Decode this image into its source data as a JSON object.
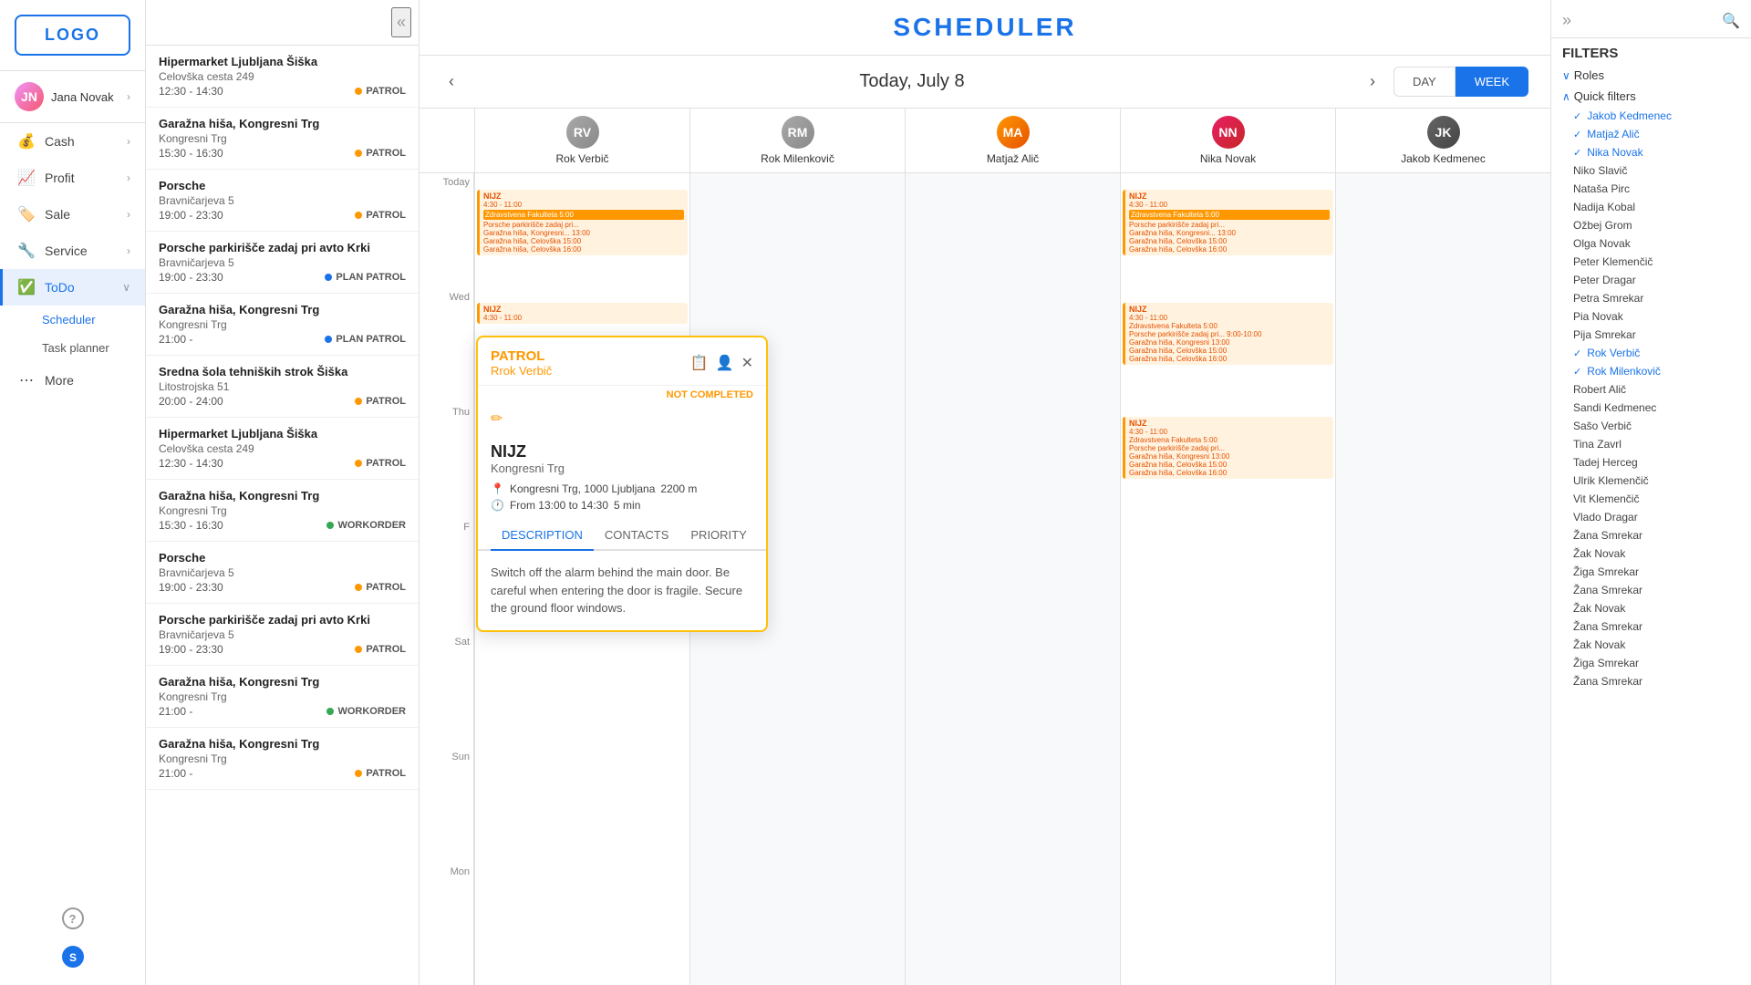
{
  "app": {
    "title": "SCHEDULER",
    "logo": "LOGO"
  },
  "user": {
    "name": "Jana Novak",
    "initials": "JN"
  },
  "nav": {
    "items": [
      {
        "id": "cash",
        "label": "Cash",
        "icon": "💰",
        "hasArrow": true
      },
      {
        "id": "profit",
        "label": "Profit",
        "icon": "📈",
        "hasArrow": true
      },
      {
        "id": "sale",
        "label": "Sale",
        "icon": "🏷️",
        "hasArrow": true
      },
      {
        "id": "service",
        "label": "Service",
        "icon": "🔧",
        "hasArrow": true
      },
      {
        "id": "todo",
        "label": "ToDo",
        "icon": "✅",
        "hasArrow": true
      },
      {
        "id": "more",
        "label": "More",
        "icon": "•••",
        "hasArrow": false
      }
    ],
    "subItems": [
      {
        "id": "scheduler",
        "label": "Scheduler",
        "active": true
      },
      {
        "id": "task-planner",
        "label": "Task planner",
        "active": false
      }
    ]
  },
  "dateNav": {
    "current": "Today, July 8",
    "prevLabel": "‹",
    "nextLabel": "›",
    "dayBtn": "DAY",
    "weekBtn": "WEEK",
    "activeView": "WEEK"
  },
  "persons": [
    {
      "id": "rok-verbic",
      "name": "Rok Verbič",
      "initials": "RV",
      "colorClass": "av-rok-verbic"
    },
    {
      "id": "rok-milenkovic",
      "name": "Rok Milenkovič",
      "initials": "RM",
      "colorClass": "av-rok-milenkovic"
    },
    {
      "id": "matjaz-alic",
      "name": "Matjaž Alič",
      "initials": "MA",
      "colorClass": "av-matjaz"
    },
    {
      "id": "nika-novak",
      "name": "Nika Novak",
      "initials": "NN",
      "colorClass": "av-nika"
    },
    {
      "id": "jakob-kedmenec",
      "name": "Jakob Kedmenec",
      "initials": "JK",
      "colorClass": "av-jakob"
    }
  ],
  "listItems": [
    {
      "title": "Hipermarket Ljubljana Šiška",
      "sub": "Celovška cesta 249",
      "time": "12:30 - 14:30",
      "badge": "PATROL",
      "dotColor": "orange"
    },
    {
      "title": "Garažna hiša, Kongresni Trg",
      "sub": "Kongresni Trg",
      "time": "15:30 - 16:30",
      "badge": "PATROL",
      "dotColor": "orange"
    },
    {
      "title": "Porsche",
      "sub": "Bravničarjeva 5",
      "time": "19:00 - 23:30",
      "badge": "PATROL",
      "dotColor": "orange"
    },
    {
      "title": "Porsche parkirišče zadaj pri avto Krki",
      "sub": "Bravničarjeva 5",
      "time": "19:00 - 23:30",
      "badge": "PLAN PATROL",
      "dotColor": "blue"
    },
    {
      "title": "Garažna hiša, Kongresni Trg",
      "sub": "Kongresni Trg",
      "time": "21:00 -",
      "badge": "PLAN PATROL",
      "dotColor": "blue"
    },
    {
      "title": "Sredna šola tehniških strok Šiška",
      "sub": "Litostrojska 51",
      "time": "20:00 - 24:00",
      "badge": "PATROL",
      "dotColor": "orange"
    },
    {
      "title": "Hipermarket Ljubljana Šiška",
      "sub": "Celovška cesta 249",
      "time": "12:30 - 14:30",
      "badge": "PATROL",
      "dotColor": "orange"
    },
    {
      "title": "Garažna hiša, Kongresni Trg",
      "sub": "Kongresni Trg",
      "time": "15:30 - 16:30",
      "badge": "WORKORDER",
      "dotColor": "green"
    },
    {
      "title": "Porsche",
      "sub": "Bravničarjeva 5",
      "time": "19:00 - 23:30",
      "badge": "PATROL",
      "dotColor": "orange"
    },
    {
      "title": "Porsche parkirišče zadaj pri avto Krki",
      "sub": "Bravničarjeva 5",
      "time": "19:00 - 23:30",
      "badge": "PATROL",
      "dotColor": "orange"
    },
    {
      "title": "Garažna hiša, Kongresni Trg",
      "sub": "Kongresni Trg",
      "time": "21:00 -",
      "badge": "WORKORDER",
      "dotColor": "green"
    },
    {
      "title": "Garažna hiša, Kongresni Trg",
      "sub": "Kongresni Trg",
      "time": "21:00 -",
      "badge": "PATROL",
      "dotColor": "orange"
    }
  ],
  "popup": {
    "badgeLabel": "PATROL",
    "personName": "Rrok Verbič",
    "status": "NOT COMPLETED",
    "locationName": "NIJZ",
    "locationAddr": "Kongresni Trg",
    "distance": "Kongresni Trg, 1000 Ljubljana",
    "distanceVal": "2200 m",
    "timeFrom": "From 13:00 to 14:30",
    "timeDuration": "5 min",
    "tabs": [
      "DESCRIPTION",
      "CONTACTS",
      "PRIORITY"
    ],
    "activeTab": "DESCRIPTION",
    "description": "Switch off the alarm behind the main door. Be careful when entering the door is fragile. Secure the ground floor windows."
  },
  "filters": {
    "title": "FILTERS",
    "sections": [
      {
        "label": "Roles",
        "expanded": true
      },
      {
        "label": "Quick filters",
        "expanded": true
      }
    ],
    "people": [
      {
        "name": "Jakob Kedmenec",
        "selected": true
      },
      {
        "name": "Matjaž Alič",
        "selected": true
      },
      {
        "name": "Nika Novak",
        "selected": true
      },
      {
        "name": "Niko Slavič",
        "selected": false
      },
      {
        "name": "Nataša Pirc",
        "selected": false
      },
      {
        "name": "Nadija Kobal",
        "selected": false
      },
      {
        "name": "Ožbej Grom",
        "selected": false
      },
      {
        "name": "Olga Novak",
        "selected": false
      },
      {
        "name": "Peter Klemenčič",
        "selected": false
      },
      {
        "name": "Peter Dragar",
        "selected": false
      },
      {
        "name": "Petra Smrekar",
        "selected": false
      },
      {
        "name": "Pia Novak",
        "selected": false
      },
      {
        "name": "Pija Smrekar",
        "selected": false
      },
      {
        "name": "Rok Verbič",
        "selected": true
      },
      {
        "name": "Rok Milenkovič",
        "selected": true
      },
      {
        "name": "Robert Alič",
        "selected": false
      },
      {
        "name": "Sandi Kedmenec",
        "selected": false
      },
      {
        "name": "Sašo Verbič",
        "selected": false
      },
      {
        "name": "Tina Zavrl",
        "selected": false
      },
      {
        "name": "Tadej Herceg",
        "selected": false
      },
      {
        "name": "Ulrik Klemenčič",
        "selected": false
      },
      {
        "name": "Vit Klemenčič",
        "selected": false
      },
      {
        "name": "Vlado Dragar",
        "selected": false
      },
      {
        "name": "Žana Smrekar",
        "selected": false
      },
      {
        "name": "Žak Novak",
        "selected": false
      },
      {
        "name": "Žiga Smrekar",
        "selected": false
      },
      {
        "name": "Žana Smrekar",
        "selected": false
      },
      {
        "name": "Žak Novak",
        "selected": false
      },
      {
        "name": "Žana Smrekar",
        "selected": false
      },
      {
        "name": "Žak Novak",
        "selected": false
      },
      {
        "name": "Žiga Smrekar",
        "selected": false
      },
      {
        "name": "Žana Smrekar",
        "selected": false
      }
    ]
  },
  "dayLabels": [
    "Today",
    "Wed",
    "Thu",
    "Fri",
    "Sat",
    "Sun",
    "Mon"
  ]
}
